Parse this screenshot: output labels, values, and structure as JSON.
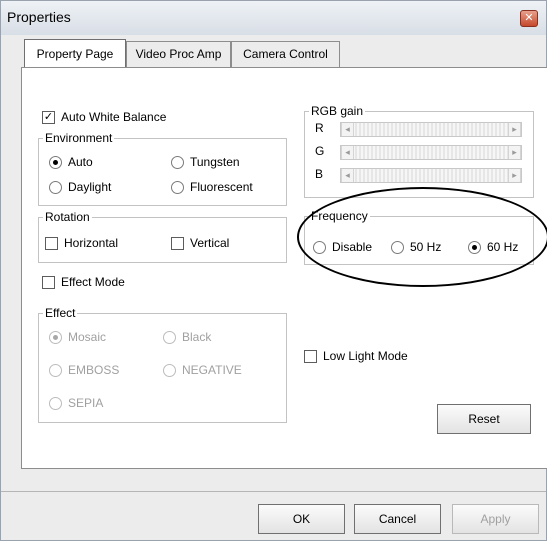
{
  "window": {
    "title": "Properties",
    "close_symbol": "✕"
  },
  "tabs": [
    {
      "label": "Property Page",
      "active": true
    },
    {
      "label": "Video Proc Amp",
      "active": false
    },
    {
      "label": "Camera Control",
      "active": false
    }
  ],
  "auto_white_balance": {
    "label": "Auto White Balance",
    "checked": true,
    "mark": "✓"
  },
  "environment": {
    "label": "Environment",
    "options": [
      "Auto",
      "Tungsten",
      "Daylight",
      "Fluorescent"
    ],
    "selected": "Auto"
  },
  "rotation": {
    "label": "Rotation",
    "horizontal": "Horizontal",
    "vertical": "Vertical"
  },
  "effect_mode": {
    "label": "Effect Mode",
    "checked": false
  },
  "effect": {
    "label": "Effect",
    "options": [
      "Mosaic",
      "Black",
      "EMBOSS",
      "NEGATIVE",
      "SEPIA"
    ],
    "selected": "Mosaic",
    "enabled": false
  },
  "rgb_gain": {
    "label": "RGB gain",
    "channels": [
      "R",
      "G",
      "B"
    ],
    "left_arrow": "◂",
    "right_arrow": "▸"
  },
  "frequency": {
    "label": "Frequency",
    "options": [
      "Disable",
      "50 Hz",
      "60 Hz"
    ],
    "selected": "60 Hz"
  },
  "low_light_mode": {
    "label": "Low Light Mode",
    "checked": false
  },
  "buttons": {
    "reset": "Reset",
    "ok": "OK",
    "cancel": "Cancel",
    "apply": "Apply"
  }
}
